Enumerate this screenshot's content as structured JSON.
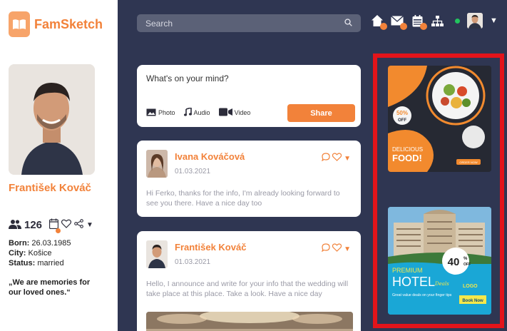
{
  "app": {
    "name": "FamSketch"
  },
  "search": {
    "placeholder": "Search"
  },
  "topbar": {
    "icons": [
      "home-icon",
      "mail-icon",
      "calendar-icon",
      "network-icon"
    ],
    "status_color": "#22c55e"
  },
  "profile": {
    "name": "František Kováč",
    "friends_count": "126",
    "born_label": "Born:",
    "born_value": "26.03.1985",
    "city_label": "City:",
    "city_value": "Košice",
    "status_label": "Status:",
    "status_value": "married",
    "quote": "„We are memories for our loved ones.“"
  },
  "composer": {
    "placeholder": "What's on your mind?",
    "photo_label": "Photo",
    "audio_label": "Audio",
    "video_label": "Video",
    "share_label": "Share"
  },
  "posts": [
    {
      "author": "Ivana Kováčová",
      "date": "01.03.2021",
      "text": "Hi Ferko, thanks for the info, I'm already looking forward to see you there. Have a nice day too"
    },
    {
      "author": "František Kováč",
      "date": "01.03.2021",
      "text": "Hello, I announce and write for your info that the wedding will take place at this place. Take a look. Have a nice day"
    }
  ],
  "ads": {
    "food": {
      "discount": "50%",
      "discount_sub": "OFF",
      "line1": "DELICIOUS",
      "line2": "FOOD!",
      "cta": "ORDER NOW"
    },
    "hotel": {
      "line1": "PREMIUM",
      "line2": "HOTEL",
      "script": "Deals",
      "discount": "40",
      "discount_unit": "%",
      "discount_sub": "OFF",
      "logo": "LOGO",
      "sub": "Great value deals on your finger tips",
      "cta": "Book Now"
    }
  },
  "colors": {
    "accent": "#f2823a",
    "sidebar_bg": "#ffffff",
    "page_bg": "#2f3652",
    "ad_frame": "#e3141a"
  }
}
